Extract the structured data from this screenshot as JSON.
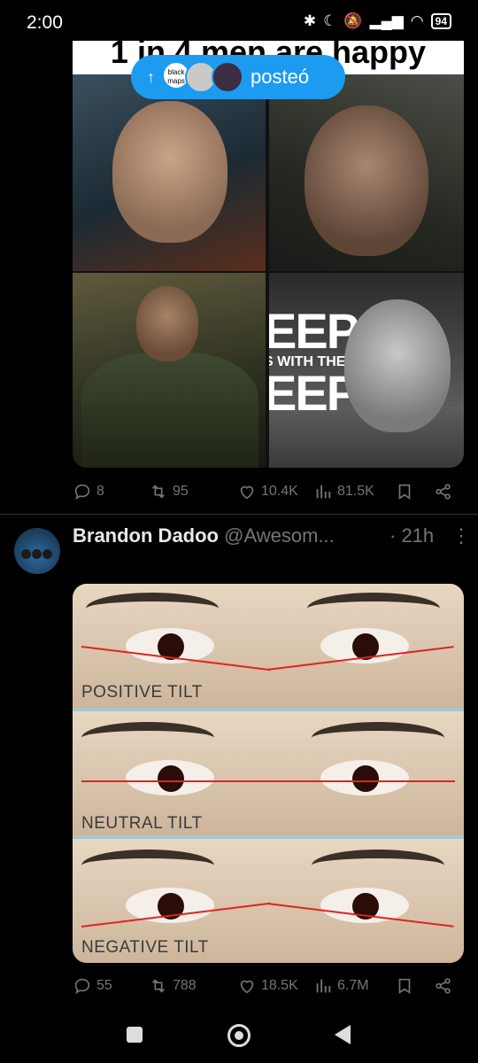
{
  "status_bar": {
    "time": "2:00",
    "battery": "94"
  },
  "reposted_pill": {
    "label": "posteó",
    "avatar_text": "black maps"
  },
  "tweet1": {
    "meme_header": "1 in 4 men are happy",
    "sign_text": "EEP",
    "sign_sub": "S WITH THE",
    "sign_text2": "EEP",
    "stats": {
      "replies": "8",
      "reposts": "95",
      "likes": "10.4K",
      "views": "81.5K"
    }
  },
  "tweet2": {
    "author_name": "Brandon Dadoo",
    "handle": "@Awesom...",
    "time": "· 21h",
    "image_labels": [
      "POSITIVE TILT",
      "NEUTRAL TILT",
      "NEGATIVE TILT"
    ],
    "stats": {
      "replies": "55",
      "reposts": "788",
      "likes": "18.5K",
      "views": "6.7M"
    }
  }
}
